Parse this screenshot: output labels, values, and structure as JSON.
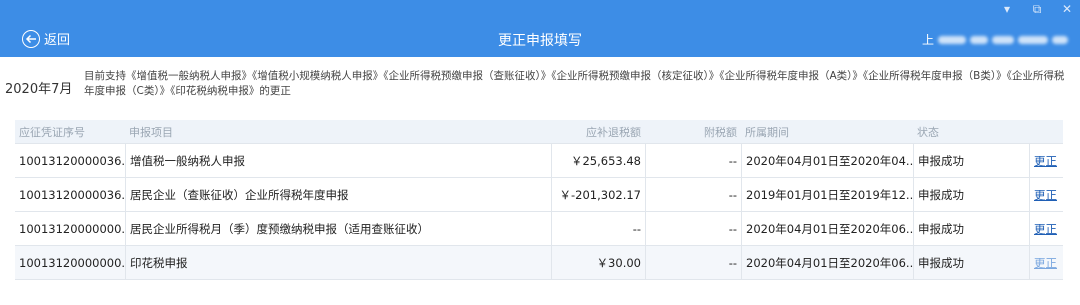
{
  "header": {
    "back_label": "返回",
    "title": "更正申报填写",
    "user_prefix": "上",
    "bg_color": "#3d8de6"
  },
  "window_controls": {
    "minimize": "▾",
    "restore": "⧉",
    "close": "✕"
  },
  "info": {
    "period": "2020年7月",
    "notice": "目前支持《增值税一般纳税人申报》《增值税小规模纳税人申报》《企业所得税预缴申报（查账征收）》《企业所得税预缴申报（核定征收）》《企业所得税年度申报（A类）》《企业所得税年度申报（B类）》《企业所得税年度申报（C类）》《印花税纳税申报》的更正"
  },
  "table": {
    "headers": [
      "应征凭证序号",
      "申报项目",
      "应补退税额",
      "附税额",
      "所属期间",
      "状态",
      ""
    ],
    "rows": [
      {
        "seq": "10013120000036...",
        "item": "增值税一般纳税人申报",
        "amount": "￥25,653.48",
        "surtax": "--",
        "period": "2020年04月01日至2020年04...",
        "status": "申报成功",
        "action": "更正"
      },
      {
        "seq": "10013120000036...",
        "item": "居民企业（查账征收）企业所得税年度申报",
        "amount": "￥-201,302.17",
        "surtax": "--",
        "period": "2019年01月01日至2019年12...",
        "status": "申报成功",
        "action": "更正"
      },
      {
        "seq": "10013120000000...",
        "item": "居民企业所得税月（季）度预缴纳税申报（适用查账征收）",
        "amount": "--",
        "surtax": "--",
        "period": "2020年04月01日至2020年06...",
        "status": "申报成功",
        "action": "更正"
      },
      {
        "seq": "10013120000000...",
        "item": "印花税申报",
        "amount": "￥30.00",
        "surtax": "--",
        "period": "2020年04月01日至2020年06...",
        "status": "申报成功",
        "action": "更正"
      }
    ]
  }
}
